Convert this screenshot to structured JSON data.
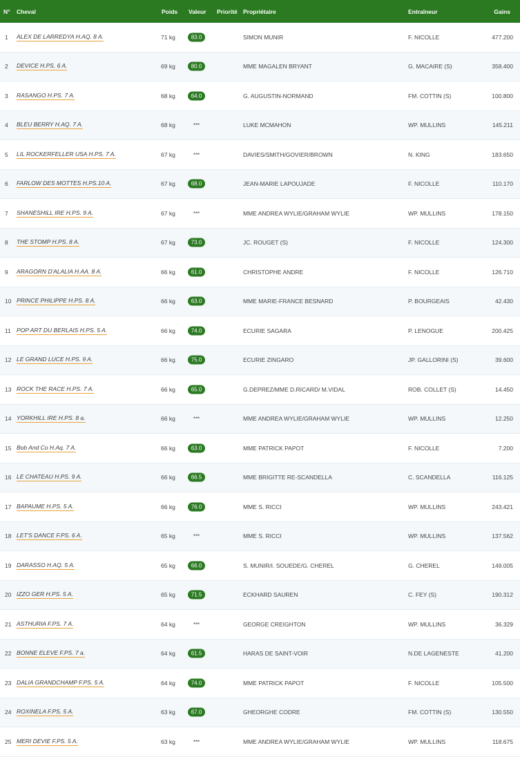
{
  "headers": {
    "num": "N°",
    "name": "Cheval",
    "weight": "Poids",
    "value": "Valeur",
    "priority": "Priorité",
    "owner": "Propriétaire",
    "trainer": "Entraîneur",
    "gains": "Gains"
  },
  "colors": {
    "accent": "#2b7a22",
    "link_underline": "#e8a23a"
  },
  "rows": [
    {
      "num": "1",
      "name": "ALEX DE LARREDYA H.AQ. 8 A.",
      "weight": "71 kg",
      "value": "83.0",
      "owner": "SIMON MUNIR",
      "trainer": "F. NICOLLE",
      "gains": "477.200"
    },
    {
      "num": "2",
      "name": "DEVICE H.PS. 6 A.",
      "weight": "69 kg",
      "value": "80.0",
      "owner": "MME MAGALEN BRYANT",
      "trainer": "G. MACAIRE (S)",
      "gains": "358.400"
    },
    {
      "num": "3",
      "name": "RASANGO H.PS. 7 A.",
      "weight": "68 kg",
      "value": "64.0",
      "owner": "G. AUGUSTIN-NORMAND",
      "trainer": "FM. COTTIN (S)",
      "gains": "100.800"
    },
    {
      "num": "4",
      "name": "BLEU BERRY H.AQ. 7 A.",
      "weight": "68 kg",
      "value": "***",
      "owner": "LUKE MCMAHON",
      "trainer": "WP. MULLINS",
      "gains": "145.211"
    },
    {
      "num": "5",
      "name": "LIL ROCKERFELLER USA H.PS. 7 A.",
      "weight": "67 kg",
      "value": "***",
      "owner": "DAVIES/SMITH/GOVIER/BROWN",
      "trainer": "N. KING",
      "gains": "183.650"
    },
    {
      "num": "6",
      "name": "FARLOW DES MOTTES H.PS.10 A.",
      "weight": "67 kg",
      "value": "68.0",
      "owner": "JEAN-MARIE LAPOUJADE",
      "trainer": "F. NICOLLE",
      "gains": "110.170"
    },
    {
      "num": "7",
      "name": "SHANESHILL IRE H.PS. 9 A.",
      "weight": "67 kg",
      "value": "***",
      "owner": "MME ANDREA WYLIE/GRAHAM WYLIE",
      "trainer": "WP. MULLINS",
      "gains": "178.150"
    },
    {
      "num": "8",
      "name": "THE STOMP H.PS. 8 A.",
      "weight": "67 kg",
      "value": "73.0",
      "owner": "JC. ROUGET (S)",
      "trainer": "F. NICOLLE",
      "gains": "124.300"
    },
    {
      "num": "9",
      "name": "ARAGORN D'ALALIA H.AA. 8 A.",
      "weight": "66 kg",
      "value": "61.0",
      "owner": "CHRISTOPHE ANDRE",
      "trainer": "F. NICOLLE",
      "gains": "126.710"
    },
    {
      "num": "10",
      "name": "PRINCE PHILIPPE H.PS. 8 A.",
      "weight": "66 kg",
      "value": "63.0",
      "owner": "MME MARIE-FRANCE BESNARD",
      "trainer": "P. BOURGEAIS",
      "gains": "42.430"
    },
    {
      "num": "11",
      "name": "POP ART DU BERLAIS H.PS. 5 A.",
      "weight": "66 kg",
      "value": "74.0",
      "owner": "ECURIE SAGARA",
      "trainer": "P. LENOGUE",
      "gains": "200.425"
    },
    {
      "num": "12",
      "name": "LE GRAND LUCE H.PS. 9 A.",
      "weight": "66 kg",
      "value": "75.0",
      "owner": "ECURIE ZINGARO",
      "trainer": "JP. GALLORINI (S)",
      "gains": "39.600"
    },
    {
      "num": "13",
      "name": "ROCK THE RACE H.PS. 7 A.",
      "weight": "66 kg",
      "value": "65.0",
      "owner": "G.DEPREZ/MME D.RICARD/ M.VIDAL",
      "trainer": "ROB. COLLET (S)",
      "gains": "14.450"
    },
    {
      "num": "14",
      "name": "YORKHILL IRE H.PS. 8 a.",
      "weight": "66 kg",
      "value": "***",
      "owner": "MME ANDREA WYLIE/GRAHAM WYLIE",
      "trainer": "WP. MULLINS",
      "gains": "12.250"
    },
    {
      "num": "15",
      "name": "Bob And Co H.Aq. 7 A.",
      "weight": "66 kg",
      "value": "63.0",
      "owner": "MME PATRICK PAPOT",
      "trainer": "F. NICOLLE",
      "gains": "7.200"
    },
    {
      "num": "16",
      "name": "LE CHATEAU H.PS. 9 A.",
      "weight": "66 kg",
      "value": "66.5",
      "owner": "MME BRIGITTE RE-SCANDELLA",
      "trainer": "C. SCANDELLA",
      "gains": "116.125"
    },
    {
      "num": "17",
      "name": "BAPAUME H.PS. 5 A.",
      "weight": "66 kg",
      "value": "76.0",
      "owner": "MME S. RICCI",
      "trainer": "WP. MULLINS",
      "gains": "243.421"
    },
    {
      "num": "18",
      "name": "LET'S DANCE F.PS. 6 A.",
      "weight": "65 kg",
      "value": "***",
      "owner": "MME S. RICCI",
      "trainer": "WP. MULLINS",
      "gains": "137.562"
    },
    {
      "num": "19",
      "name": "DARASSO H.AQ. 5 A.",
      "weight": "65 kg",
      "value": "66.0",
      "owner": "S. MUNIR/I. SOUEDE/G. CHEREL",
      "trainer": "G. CHEREL",
      "gains": "149.005"
    },
    {
      "num": "20",
      "name": "IZZO GER H.PS. 5 A.",
      "weight": "65 kg",
      "value": "71.5",
      "owner": "ECKHARD SAUREN",
      "trainer": "C. FEY (S)",
      "gains": "190.312"
    },
    {
      "num": "21",
      "name": "ASTHURIA F.PS. 7 A.",
      "weight": "64 kg",
      "value": "***",
      "owner": "GEORGE CREIGHTON",
      "trainer": "WP. MULLINS",
      "gains": "36.329"
    },
    {
      "num": "22",
      "name": "BONNE ELEVE F.PS. 7 a.",
      "weight": "64 kg",
      "value": "61.5",
      "owner": "HARAS DE SAINT-VOIR",
      "trainer": "N.DE LAGENESTE",
      "gains": "41.200"
    },
    {
      "num": "23",
      "name": "DALIA GRANDCHAMP F.PS. 5 A.",
      "weight": "64 kg",
      "value": "74.0",
      "owner": "MME PATRICK PAPOT",
      "trainer": "F. NICOLLE",
      "gains": "105.500"
    },
    {
      "num": "24",
      "name": "ROXINELA F.PS. 5 A.",
      "weight": "63 kg",
      "value": "67.0",
      "owner": "GHEORGHE CODRE",
      "trainer": "FM. COTTIN (S)",
      "gains": "130.550"
    },
    {
      "num": "25",
      "name": "MERI DEVIE F.PS. 5 A.",
      "weight": "63 kg",
      "value": "***",
      "owner": "MME ANDREA WYLIE/GRAHAM WYLIE",
      "trainer": "WP. MULLINS",
      "gains": "118.675"
    }
  ]
}
